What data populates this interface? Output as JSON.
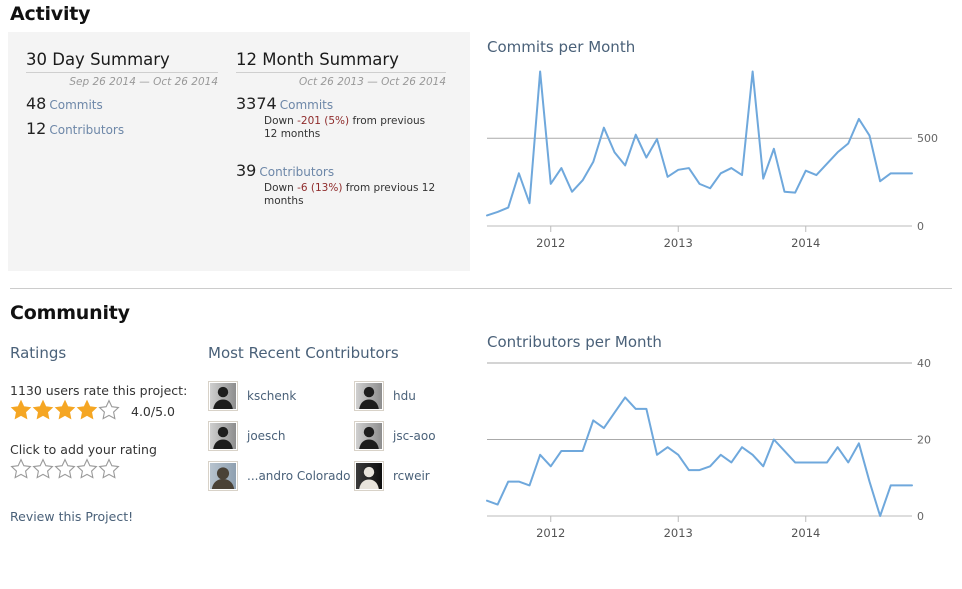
{
  "activity": {
    "heading": "Activity",
    "summary_30day": {
      "title": "30 Day Summary",
      "range": "Sep 26 2014 — Oct 26 2014",
      "commits_count": "48",
      "commits_label": "Commits",
      "contributors_count": "12",
      "contributors_label": "Contributors"
    },
    "summary_12month": {
      "title": "12 Month Summary",
      "range": "Oct 26 2013 — Oct 26 2014",
      "commits_count": "3374",
      "commits_label": "Commits",
      "commits_change_prefix": "Down ",
      "commits_change_value": "-201 (5%)",
      "commits_change_suffix": " from previous 12 months",
      "contributors_count": "39",
      "contributors_label": "Contributors",
      "contributors_change_prefix": "Down ",
      "contributors_change_value": "-6 (13%)",
      "contributors_change_suffix": " from previous 12 months"
    }
  },
  "community": {
    "heading": "Community",
    "ratings": {
      "heading": "Ratings",
      "users_rate_text": "1130 users rate this project:",
      "score_text": "4.0/5.0",
      "filled_stars": 4,
      "total_stars": 5,
      "add_rating_label": "Click to add your rating",
      "add_rating_stars": 5,
      "review_link": "Review this Project!"
    },
    "contributors": {
      "heading": "Most Recent Contributors",
      "items": [
        {
          "name": "kschenk",
          "avatar": "silhouette"
        },
        {
          "name": "hdu",
          "avatar": "silhouette"
        },
        {
          "name": "joesch",
          "avatar": "silhouette"
        },
        {
          "name": "jsc-aoo",
          "avatar": "silhouette"
        },
        {
          "name": "...andro Colorado",
          "avatar": "photo-man"
        },
        {
          "name": "rcweir",
          "avatar": "photo-dark"
        }
      ]
    }
  },
  "colors": {
    "accent_link": "#4a6179",
    "series_line": "#6fa8dc",
    "star_filled": "#f5a623",
    "star_empty": "#ffffff",
    "negative_text": "#8f2b2b",
    "panel_bg": "#f4f4f4"
  },
  "chart_data": [
    {
      "type": "line",
      "title": "Commits per Month",
      "xlabel": "",
      "ylabel": "",
      "ylim": [
        0,
        900
      ],
      "yticks": [
        0,
        500
      ],
      "ytick_labels": [
        "0",
        "500"
      ],
      "grid": true,
      "legend": "none",
      "xtick_labels": [
        "2012",
        "2013",
        "2014"
      ],
      "xtick_positions": [
        6,
        18,
        30
      ],
      "x": [
        "2011-06",
        "2011-07",
        "2011-08",
        "2011-09",
        "2011-10",
        "2011-11",
        "2011-12",
        "2012-01",
        "2012-02",
        "2012-03",
        "2012-04",
        "2012-05",
        "2012-06",
        "2012-07",
        "2012-08",
        "2012-09",
        "2012-10",
        "2012-11",
        "2012-12",
        "2013-01",
        "2013-02",
        "2013-03",
        "2013-04",
        "2013-05",
        "2013-06",
        "2013-07",
        "2013-08",
        "2013-09",
        "2013-10",
        "2013-11",
        "2013-12",
        "2014-01",
        "2014-02",
        "2014-03",
        "2014-04",
        "2014-05",
        "2014-06",
        "2014-07",
        "2014-08",
        "2014-09",
        "2014-10"
      ],
      "values": [
        60,
        80,
        105,
        300,
        130,
        880,
        240,
        330,
        195,
        260,
        365,
        560,
        420,
        345,
        520,
        390,
        495,
        280,
        320,
        330,
        240,
        215,
        300,
        330,
        290,
        880,
        270,
        440,
        195,
        190,
        315,
        290,
        355,
        420,
        470,
        610,
        515,
        255,
        300,
        300,
        300
      ],
      "series": [
        {
          "name": "Commits",
          "values": [
            60,
            80,
            105,
            300,
            130,
            880,
            240,
            330,
            195,
            260,
            365,
            560,
            420,
            345,
            520,
            390,
            495,
            280,
            320,
            330,
            240,
            215,
            300,
            330,
            290,
            880,
            270,
            440,
            195,
            190,
            315,
            290,
            355,
            420,
            470,
            610,
            515,
            255,
            300,
            300,
            300
          ]
        }
      ]
    },
    {
      "type": "line",
      "title": "Contributors per Month",
      "xlabel": "",
      "ylabel": "",
      "ylim": [
        0,
        40
      ],
      "yticks": [
        0,
        20,
        40
      ],
      "ytick_labels": [
        "0",
        "20",
        "40"
      ],
      "grid": true,
      "legend": "none",
      "xtick_labels": [
        "2012",
        "2013",
        "2014"
      ],
      "xtick_positions": [
        6,
        18,
        30
      ],
      "x": [
        "2011-06",
        "2011-07",
        "2011-08",
        "2011-09",
        "2011-10",
        "2011-11",
        "2011-12",
        "2012-01",
        "2012-02",
        "2012-03",
        "2012-04",
        "2012-05",
        "2012-06",
        "2012-07",
        "2012-08",
        "2012-09",
        "2012-10",
        "2012-11",
        "2012-12",
        "2013-01",
        "2013-02",
        "2013-03",
        "2013-04",
        "2013-05",
        "2013-06",
        "2013-07",
        "2013-08",
        "2013-09",
        "2013-10",
        "2013-11",
        "2013-12",
        "2014-01",
        "2014-02",
        "2014-03",
        "2014-04",
        "2014-05",
        "2014-06",
        "2014-07",
        "2014-08",
        "2014-09",
        "2014-10"
      ],
      "values": [
        4,
        3,
        9,
        9,
        8,
        16,
        13,
        17,
        17,
        17,
        25,
        23,
        27,
        31,
        28,
        28,
        16,
        18,
        16,
        12,
        12,
        13,
        16,
        14,
        18,
        16,
        13,
        20,
        17,
        14,
        14,
        14,
        14,
        18,
        14,
        19,
        9,
        0,
        8,
        8,
        8
      ],
      "series": [
        {
          "name": "Contributors",
          "values": [
            4,
            3,
            9,
            9,
            8,
            16,
            13,
            17,
            17,
            17,
            25,
            23,
            27,
            31,
            28,
            28,
            16,
            18,
            16,
            12,
            12,
            13,
            16,
            14,
            18,
            16,
            13,
            20,
            17,
            14,
            14,
            14,
            14,
            18,
            14,
            19,
            9,
            0,
            8,
            8,
            8
          ]
        }
      ]
    }
  ]
}
